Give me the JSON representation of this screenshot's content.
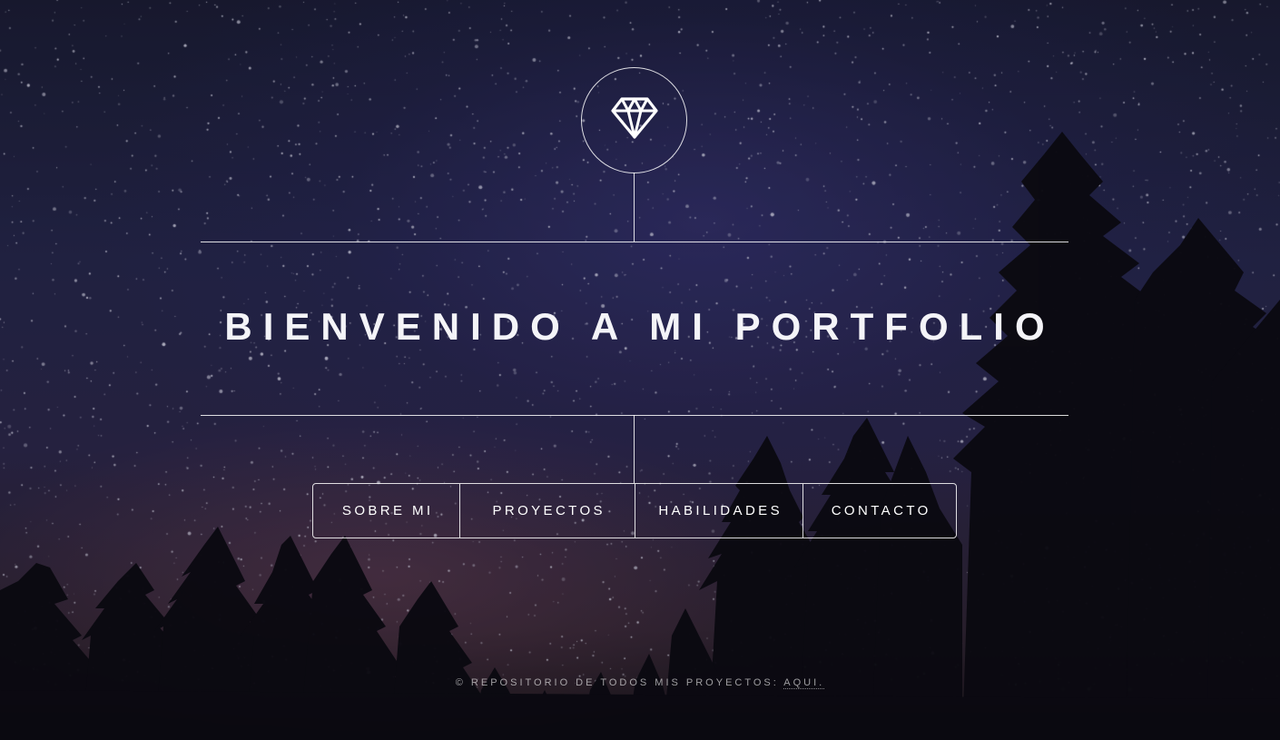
{
  "header": {
    "logo_icon": "diamond-icon",
    "title": "BIENVENIDO A MI PORTFOLIO"
  },
  "nav": {
    "items": [
      {
        "label": "SOBRE MI"
      },
      {
        "label": "PROYECTOS"
      },
      {
        "label": "HABILIDADES"
      },
      {
        "label": "CONTACTO"
      }
    ]
  },
  "footer": {
    "text": "© REPOSITORIO DE TODOS MIS PROYECTOS: ",
    "link_label": "AQUI."
  },
  "colors": {
    "text": "#ffffff",
    "sky_top": "#1a1c33",
    "sky_mid": "#25264a",
    "horizon": "#2e2330",
    "trees": "#0b0a10"
  }
}
